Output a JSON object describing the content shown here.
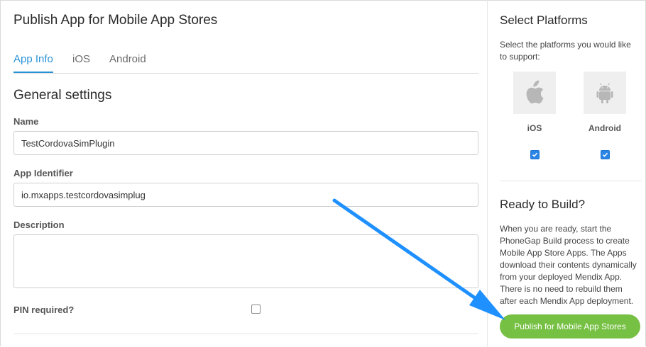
{
  "main": {
    "title": "Publish App for Mobile App Stores",
    "tabs": [
      {
        "label": "App Info",
        "active": true
      },
      {
        "label": "iOS",
        "active": false
      },
      {
        "label": "Android",
        "active": false
      }
    ],
    "section_title": "General settings",
    "fields": {
      "name": {
        "label": "Name",
        "value": "TestCordovaSimPlugin"
      },
      "app_identifier": {
        "label": "App Identifier",
        "value": "io.mxapps.testcordovasimplug"
      },
      "description": {
        "label": "Description",
        "value": ""
      },
      "pin_required": {
        "label": "PIN required?",
        "checked": false
      }
    }
  },
  "platforms": {
    "title": "Select Platforms",
    "description": "Select the platforms you would like to support:",
    "items": [
      {
        "label": "iOS",
        "icon": "apple-icon",
        "checked": true
      },
      {
        "label": "Android",
        "icon": "android-icon",
        "checked": true
      }
    ]
  },
  "build": {
    "title": "Ready to Build?",
    "description": "When you are ready, start the PhoneGap Build process to create Mobile App Store Apps. The Apps download their contents dynamically from your deployed Mendix App. There is no need to rebuild them after each Mendix App deployment.",
    "button_label": "Publish for Mobile App Stores"
  },
  "colors": {
    "accent": "#2a93d5",
    "button": "#76c043",
    "arrow": "#1e90ff"
  }
}
